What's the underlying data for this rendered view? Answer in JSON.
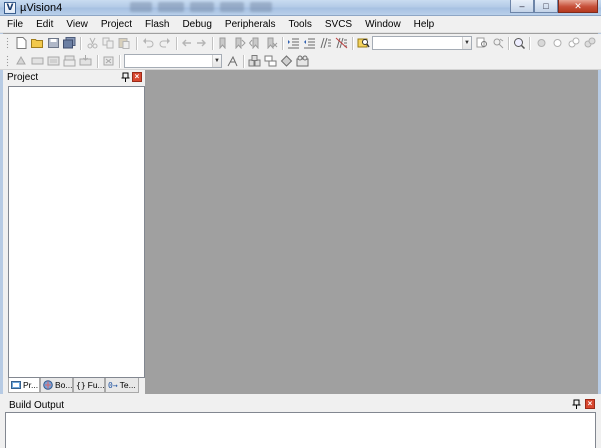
{
  "window": {
    "title": "µVision4",
    "app_icon_glyph": "V",
    "minimize_glyph": "–",
    "maximize_glyph": "□",
    "close_glyph": "✕"
  },
  "menu": {
    "items": [
      "File",
      "Edit",
      "View",
      "Project",
      "Flash",
      "Debug",
      "Peripherals",
      "Tools",
      "SVCS",
      "Window",
      "Help"
    ]
  },
  "project_panel": {
    "title": "Project",
    "pin_glyph": "ᵖ",
    "close_glyph": "×",
    "tabs": [
      {
        "label": "Pr...",
        "icon": "project-tab-icon"
      },
      {
        "label": "Bo...",
        "icon": "books-tab-icon"
      },
      {
        "label": "Fu...",
        "icon": "functions-tab-icon",
        "prefix": "{}"
      },
      {
        "label": "Te...",
        "icon": "templates-tab-icon",
        "prefix": "0→"
      }
    ]
  },
  "build_output": {
    "title": "Build Output",
    "pin_glyph": "ᵖ",
    "close_glyph": "×"
  },
  "colors": {
    "editor_background": "#a0a0a0",
    "chrome": "#f0f0f0",
    "close_red": "#d8472f"
  }
}
